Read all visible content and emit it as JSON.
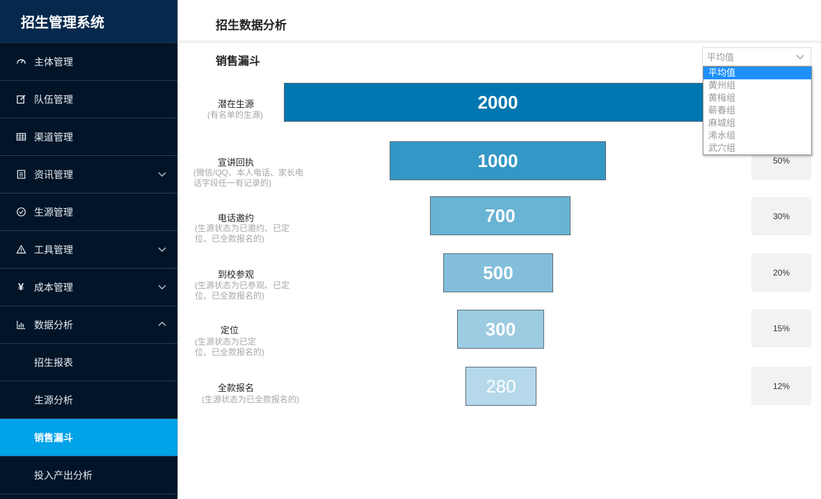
{
  "app": {
    "title": "招生管理系统"
  },
  "header": {
    "title": "招生数据分析"
  },
  "section": {
    "title": "销售漏斗"
  },
  "sidebar": {
    "items": [
      {
        "label": "主体管理",
        "icon": "dashboard-icon"
      },
      {
        "label": "队伍管理",
        "icon": "edit-icon"
      },
      {
        "label": "渠道管理",
        "icon": "table-icon"
      },
      {
        "label": "资讯管理",
        "icon": "document-icon",
        "expandable": true
      },
      {
        "label": "生源管理",
        "icon": "check-circle-icon"
      },
      {
        "label": "工具管理",
        "icon": "warning-icon",
        "expandable": true
      },
      {
        "label": "成本管理",
        "icon": "yen-icon",
        "expandable": true
      },
      {
        "label": "数据分析",
        "icon": "bar-chart-icon",
        "expanded": true
      }
    ],
    "sub_items": [
      {
        "label": "招生报表"
      },
      {
        "label": "生源分析"
      },
      {
        "label": "销售漏斗",
        "active": true
      },
      {
        "label": "投入产出分析"
      }
    ],
    "active_color": "#00a2e8",
    "background": "#011428"
  },
  "filter": {
    "selected": "平均值",
    "options": [
      "平均值",
      "黄州组",
      "黄梅组",
      "蕲春组",
      "麻城组",
      "浠水组",
      "武穴组"
    ],
    "highlight_color": "#1e90ff"
  },
  "funnel": {
    "stages": [
      {
        "name": "潜在生源",
        "desc": "(有名单的生源)",
        "value": "2000",
        "percent": "",
        "color": "#0077b0"
      },
      {
        "name": "宣讲回执",
        "desc": "(微信/QQ、本人电话、家长电话字段任一有记录的)",
        "value": "1000",
        "percent": "50%",
        "color": "#3497c5"
      },
      {
        "name": "电话邀约",
        "desc": "(生源状态为已邀约、已定位、已全款报名的)",
        "value": "700",
        "percent": "30%",
        "color": "#69b3d4"
      },
      {
        "name": "到校参观",
        "desc": "(生源状态为已参观、已定位、已全款报名的)",
        "value": "500",
        "percent": "20%",
        "color": "#82bedb"
      },
      {
        "name": "定位",
        "desc": "(生源状态为已定位、已全款报名的)",
        "value": "300",
        "percent": "15%",
        "color": "#9ccbe2"
      },
      {
        "name": "全款报名",
        "desc": "(生源状态为已全款报名的)",
        "value": "280",
        "percent": "12%",
        "color": "#b5d8ea"
      }
    ]
  }
}
